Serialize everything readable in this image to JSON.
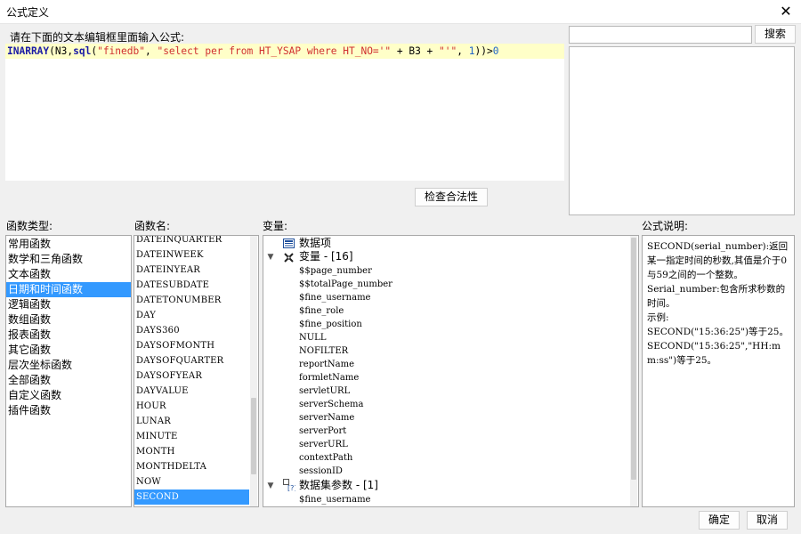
{
  "window": {
    "title": "公式定义"
  },
  "editor": {
    "label": "请在下面的文本编辑框里面输入公式:",
    "formula": {
      "fn1": "INARRAY",
      "p1": "(N3,",
      "fn2": "sql",
      "p2": "(",
      "s1": "\"finedb\"",
      "p3": ", ",
      "s2": "\"select per from HT_YSAP where HT_NO='\"",
      "p4": " + B3 + ",
      "s3": "\"'\"",
      "p5": ", ",
      "n1": "1",
      "p6": "))>",
      "n2": "0"
    }
  },
  "search": {
    "value": "",
    "button_label": "搜索"
  },
  "check_button_label": "检查合法性",
  "labels": {
    "func_types": "函数类型:",
    "func_names": "函数名:",
    "variables": "变量:",
    "formula_desc": "公式说明:"
  },
  "func_types": {
    "items": [
      "常用函数",
      "数学和三角函数",
      "文本函数",
      "日期和时间函数",
      "逻辑函数",
      "数组函数",
      "报表函数",
      "其它函数",
      "层次坐标函数",
      "全部函数",
      "自定义函数",
      "插件函数"
    ],
    "selected": "日期和时间函数"
  },
  "func_names": {
    "items": [
      "DATEINQUARTER",
      "DATEINWEEK",
      "DATEINYEAR",
      "DATESUBDATE",
      "DATETONUMBER",
      "DAY",
      "DAYS360",
      "DAYSOFMONTH",
      "DAYSOFQUARTER",
      "DAYSOFYEAR",
      "DAYVALUE",
      "HOUR",
      "LUNAR",
      "MINUTE",
      "MONTH",
      "MONTHDELTA",
      "NOW",
      "SECOND"
    ],
    "selected": "SECOND"
  },
  "variables": {
    "data_items": "数据项",
    "variable_group": "变量 - [16]",
    "variable_items": [
      "$$page_number",
      "$$totalPage_number",
      "$fine_username",
      "$fine_role",
      "$fine_position",
      "NULL",
      "NOFILTER",
      "reportName",
      "formletName",
      "servletURL",
      "serverSchema",
      "serverName",
      "serverPort",
      "serverURL",
      "contextPath",
      "sessionID"
    ],
    "dataset_group": "数据集参数 - [1]",
    "dataset_items": [
      "$fine_username"
    ]
  },
  "description": {
    "lines": [
      "SECOND(serial_number):返回某一指定时间的秒数,其值是介于0与59之间的一个整数。",
      "Serial_number:包含所求秒数的时间。",
      "示例:",
      "SECOND(\"15:36:25\")等于25。",
      "SECOND(\"15:36:25\",\"HH:mm:ss\")等于25。"
    ]
  },
  "footer": {
    "ok_label": "确定",
    "cancel_label": "取消"
  },
  "colors": {
    "selection": "#3399ff",
    "editor_highlight": "#ffffc8",
    "function_name": "#1a1aa6",
    "string": "#d03030"
  }
}
